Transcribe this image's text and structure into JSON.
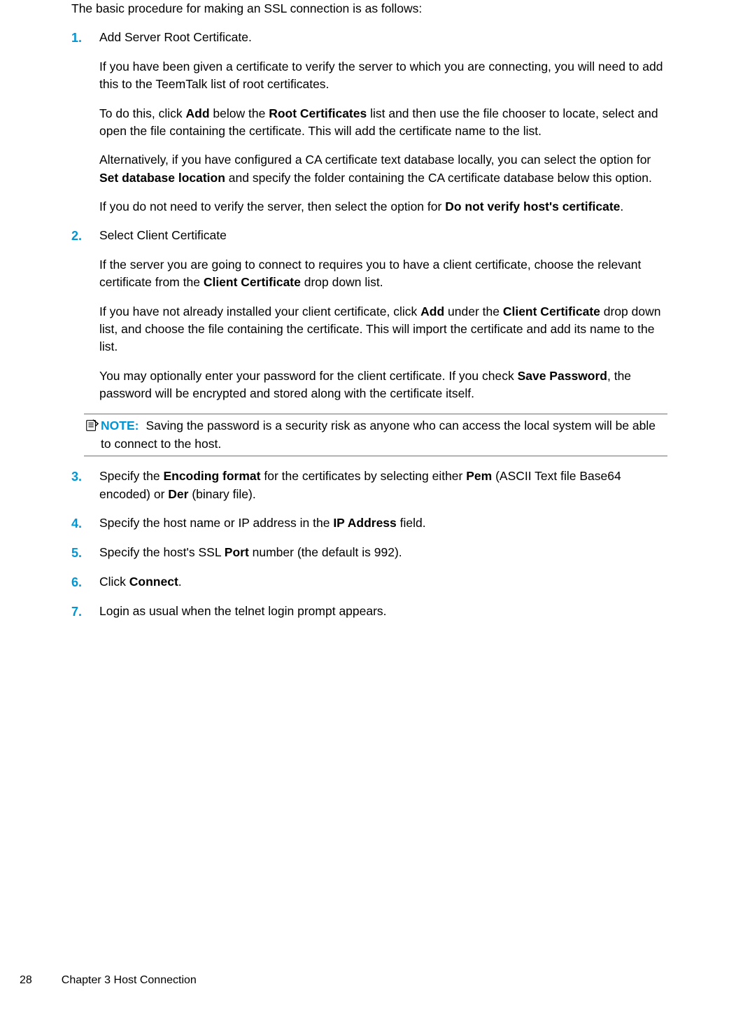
{
  "intro": "The basic procedure for making an SSL connection is as follows:",
  "steps": {
    "s1": {
      "num": "1.",
      "title": "Add Server Root Certificate.",
      "p1": "If you have been given a certificate to verify the server to which you are connecting, you will need to add this to the TeemTalk list of root certificates.",
      "p2a": "To do this, click ",
      "p2b": "Add",
      "p2c": " below the ",
      "p2d": "Root Certificates",
      "p2e": " list and then use the file chooser to locate, select and open the file containing the certificate. This will add the certificate name to the list.",
      "p3a": "Alternatively, if you have configured a CA certificate text database locally, you can select the option for ",
      "p3b": "Set database location",
      "p3c": " and specify the folder containing the CA certificate database below this option.",
      "p4a": "If you do not need to verify the server, then select the option for ",
      "p4b": "Do not verify host's certificate",
      "p4c": "."
    },
    "s2": {
      "num": "2.",
      "title": "Select Client Certificate",
      "p1a": "If the server you are going to connect to requires you to have a client certificate, choose the relevant certificate from the ",
      "p1b": "Client Certificate",
      "p1c": " drop down list.",
      "p2a": "If you have not already installed your client certificate, click ",
      "p2b": "Add",
      "p2c": " under the ",
      "p2d": "Client Certificate",
      "p2e": " drop down list, and choose the file containing the certificate. This will import the certificate and add its name to the list.",
      "p3a": "You may optionally enter your password for the client certificate. If you check ",
      "p3b": "Save Password",
      "p3c": ", the password will be encrypted and stored along with the certificate itself."
    },
    "note": {
      "label": "NOTE:",
      "text": "Saving the password is a security risk as anyone who can access the local system will be able to connect to the host."
    },
    "s3": {
      "num": "3.",
      "a": "Specify the ",
      "b": "Encoding format",
      "c": " for the certificates by selecting either ",
      "d": "Pem",
      "e": " (ASCII Text file Base64 encoded) or ",
      "f": "Der",
      "g": " (binary file)."
    },
    "s4": {
      "num": "4.",
      "a": "Specify the host name or IP address in the ",
      "b": "IP Address",
      "c": " field."
    },
    "s5": {
      "num": "5.",
      "a": "Specify the host's SSL ",
      "b": "Port",
      "c": " number (the default is 992)."
    },
    "s6": {
      "num": "6.",
      "a": "Click ",
      "b": "Connect",
      "c": "."
    },
    "s7": {
      "num": "7.",
      "a": "Login as usual when the telnet login prompt appears."
    }
  },
  "footer": {
    "page": "28",
    "chapter": "Chapter 3   Host Connection"
  }
}
